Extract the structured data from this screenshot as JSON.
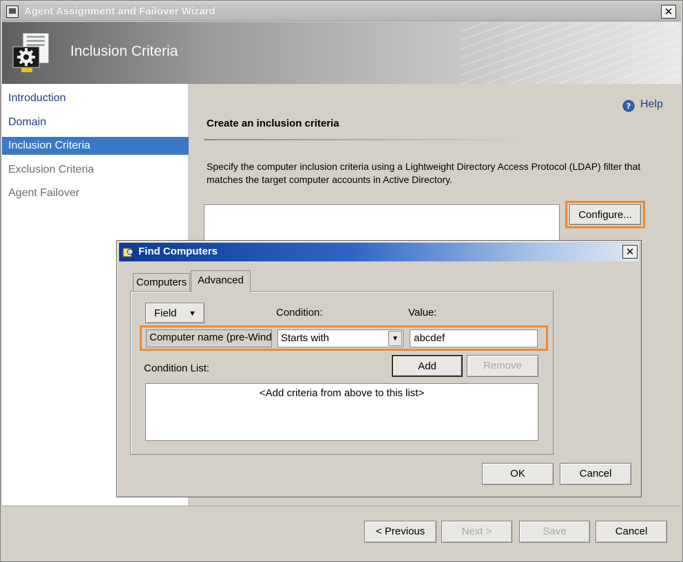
{
  "wizard": {
    "title": "Agent Assignment and Failover Wizard",
    "header_title": "Inclusion Criteria",
    "close_label": "✕"
  },
  "nav": {
    "items": [
      {
        "label": "Introduction",
        "state": "done"
      },
      {
        "label": "Domain",
        "state": "done"
      },
      {
        "label": "Inclusion Criteria",
        "state": "selected"
      },
      {
        "label": "Exclusion Criteria",
        "state": "pending"
      },
      {
        "label": "Agent Failover",
        "state": "pending"
      }
    ]
  },
  "content": {
    "help_label": "Help",
    "section_title": "Create an inclusion criteria",
    "description": "Specify the computer inclusion criteria using a Lightweight Directory Access Protocol (LDAP) filter that matches the target computer accounts in Active Directory.",
    "ldap_filter_value": "",
    "configure_label": "Configure..."
  },
  "find_dialog": {
    "title": "Find Computers",
    "close_label": "✕",
    "tabs": [
      {
        "label": "Computers",
        "active": false
      },
      {
        "label": "Advanced",
        "active": true
      }
    ],
    "field_button_label": "Field",
    "condition_label": "Condition:",
    "value_label": "Value:",
    "field_value": "Computer name (pre-Wind",
    "condition_selected": "Starts with",
    "value_input": "abcdef",
    "add_label": "Add",
    "remove_label": "Remove",
    "condition_list_label": "Condition List:",
    "condition_list_placeholder": "<Add criteria from above to this list>",
    "ok_label": "OK",
    "cancel_label": "Cancel"
  },
  "footer": {
    "previous_label": "< Previous",
    "next_label": "Next >",
    "save_label": "Save",
    "cancel_label": "Cancel"
  },
  "colors": {
    "highlight_orange": "#ef8a2e",
    "nav_selected": "#3a79c6",
    "dialog_title_blue": "#0b3b94"
  }
}
